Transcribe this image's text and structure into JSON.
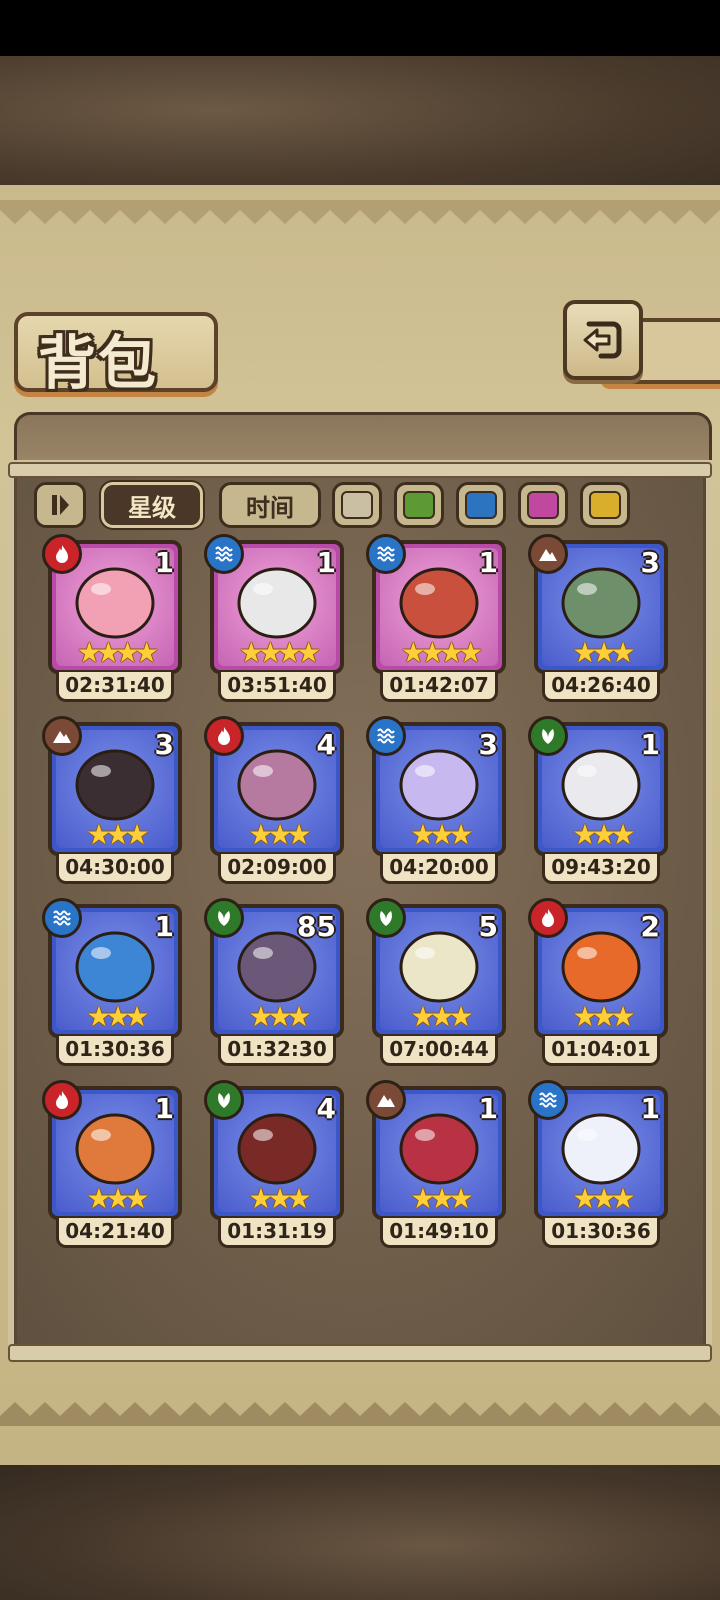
{
  "header": {
    "title": "背包"
  },
  "filters": {
    "sort_icon": "sort-toggle-icon",
    "star_label": "星级",
    "time_label": "时间",
    "colors": [
      {
        "name": "gray",
        "hex": "#cbbfa3"
      },
      {
        "name": "green",
        "hex": "#5c9a34"
      },
      {
        "name": "blue",
        "hex": "#2c74c0"
      },
      {
        "name": "purple",
        "hex": "#c0489e"
      },
      {
        "name": "yellow",
        "hex": "#d8ae2c"
      }
    ]
  },
  "colors": {
    "element_fire": "#c8242a",
    "element_water": "#2a74c8",
    "element_earth": "#7a4a36",
    "element_nature": "#2f7a2a",
    "rarity_purple": "#b84aa8",
    "rarity_blue": "#3c58c8"
  },
  "items": [
    {
      "element": "fire",
      "rarity": "purple",
      "count": "1",
      "stars": 4,
      "timer": "02:31:40",
      "creature": "pink-crowned-egg-icon"
    },
    {
      "element": "water",
      "rarity": "purple",
      "count": "1",
      "stars": 4,
      "timer": "03:51:40",
      "creature": "panda-bandit-icon"
    },
    {
      "element": "water",
      "rarity": "purple",
      "count": "1",
      "stars": 4,
      "timer": "01:42:07",
      "creature": "feathered-bean-icon"
    },
    {
      "element": "earth",
      "rarity": "blue",
      "count": "3",
      "stars": 3,
      "timer": "04:26:40",
      "creature": "green-cloak-beast-icon"
    },
    {
      "element": "earth",
      "rarity": "blue",
      "count": "3",
      "stars": 3,
      "timer": "04:30:00",
      "creature": "dark-beetle-icon"
    },
    {
      "element": "fire",
      "rarity": "blue",
      "count": "4",
      "stars": 3,
      "timer": "02:09:00",
      "creature": "spotted-mushroom-icon"
    },
    {
      "element": "water",
      "rarity": "blue",
      "count": "3",
      "stars": 3,
      "timer": "04:20:00",
      "creature": "lavender-jelly-icon"
    },
    {
      "element": "nature",
      "rarity": "blue",
      "count": "1",
      "stars": 3,
      "timer": "09:43:20",
      "creature": "rainbow-orb-ghost-icon"
    },
    {
      "element": "water",
      "rarity": "blue",
      "count": "1",
      "stars": 3,
      "timer": "01:30:36",
      "creature": "blue-eye-sprite-icon"
    },
    {
      "element": "nature",
      "rarity": "blue",
      "count": "85",
      "stars": 3,
      "timer": "01:32:30",
      "creature": "purple-egg-icon"
    },
    {
      "element": "nature",
      "rarity": "blue",
      "count": "5",
      "stars": 3,
      "timer": "07:00:44",
      "creature": "white-bud-icon"
    },
    {
      "element": "fire",
      "rarity": "blue",
      "count": "2",
      "stars": 3,
      "timer": "01:04:01",
      "creature": "flame-ram-icon"
    },
    {
      "element": "fire",
      "rarity": "blue",
      "count": "1",
      "stars": 3,
      "timer": "04:21:40",
      "creature": "fire-swirl-icon"
    },
    {
      "element": "nature",
      "rarity": "blue",
      "count": "4",
      "stars": 3,
      "timer": "01:31:19",
      "creature": "ladybug-hat-icon"
    },
    {
      "element": "earth",
      "rarity": "blue",
      "count": "1",
      "stars": 3,
      "timer": "01:49:10",
      "creature": "red-helmet-icon"
    },
    {
      "element": "water",
      "rarity": "blue",
      "count": "1",
      "stars": 3,
      "timer": "01:30:36",
      "creature": "sailor-hat-icon"
    }
  ]
}
